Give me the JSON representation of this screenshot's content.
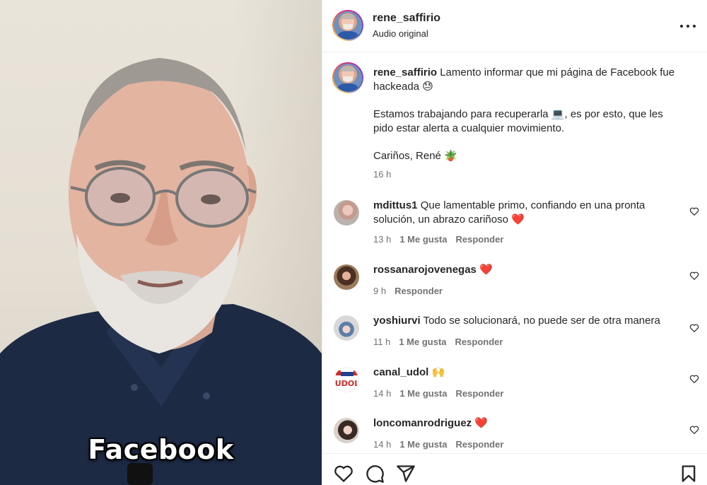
{
  "video": {
    "caption_overlay": "Facebook"
  },
  "header": {
    "username": "rene_saffirio",
    "subtitle": "Audio original",
    "icons": {
      "more": "more-options-icon"
    }
  },
  "post": {
    "username": "rene_saffirio",
    "paragraphs": [
      "Lamento informar que mi página de Facebook fue hackeada 😓",
      "Estamos trabajando para recuperarla 💻, es por esto, que les pido estar alerta a cualquier movimiento.",
      "Cariños, René 🪴"
    ],
    "time": "16 h"
  },
  "comments": [
    {
      "username": "mdittus1",
      "text": "Que lamentable primo, confiando en una pronta solución, un abrazo cariñoso ❤️",
      "time": "13 h",
      "likes": "1 Me gusta",
      "reply": "Responder"
    },
    {
      "username": "rossanarojovenegas",
      "text": "❤️",
      "time": "9 h",
      "likes": "",
      "reply": "Responder"
    },
    {
      "username": "yoshiurvi",
      "text": "Todo se solucionará, no puede ser de otra manera",
      "time": "11 h",
      "likes": "1 Me gusta",
      "reply": "Responder"
    },
    {
      "username": "canal_udol",
      "text": "🙌",
      "time": "14 h",
      "likes": "1 Me gusta",
      "reply": "Responder",
      "avatar_logo_text": "UDOL"
    },
    {
      "username": "loncomanrodriguez",
      "text": "❤️",
      "time": "14 h",
      "likes": "1 Me gusta",
      "reply": "Responder"
    }
  ],
  "actions": {
    "icons": [
      "heart-icon",
      "comment-icon",
      "share-icon",
      "bookmark-icon"
    ]
  },
  "colors": {
    "text": "#262626",
    "muted": "#737373",
    "border": "#efefef",
    "heart_red": "#ed4956"
  }
}
